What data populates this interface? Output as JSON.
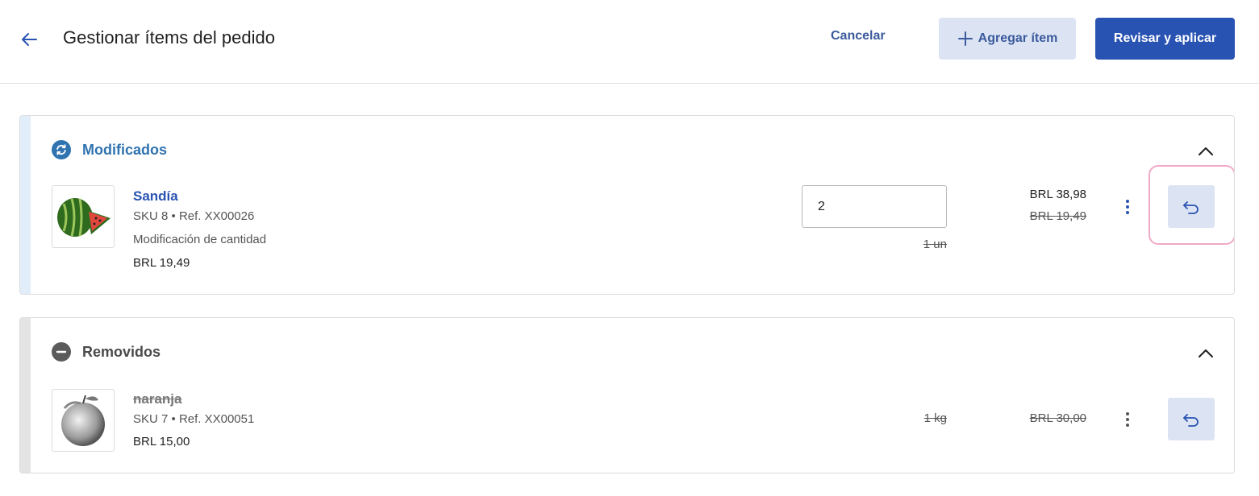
{
  "colors": {
    "primary": "#2953b3",
    "link": "#3a5a9c",
    "secondary_bg": "#dce4f4",
    "modified_accent": "#2f73b0",
    "removed_accent": "#5b5b5b",
    "highlight": "#f0a9c6"
  },
  "header": {
    "back_icon": "arrow-left-icon",
    "title": "Gestionar ítems del pedido",
    "cancel_label": "Cancelar",
    "add_label": "Agregar ítem",
    "add_icon": "plus-icon",
    "apply_label": "Revisar y aplicar"
  },
  "sections": {
    "modified": {
      "title": "Modificados",
      "icon": "sync-icon",
      "items": [
        {
          "name": "Sandía",
          "sku": "SKU 8 • Ref. XX00026",
          "change": "Modificación de cantidad",
          "unit_price": "BRL 19,49",
          "quantity_value": "2",
          "old_quantity": "1 un",
          "new_total": "BRL 38,98",
          "old_total": "BRL 19,49"
        }
      ]
    },
    "removed": {
      "title": "Removidos",
      "icon": "minus-circle-icon",
      "items": [
        {
          "name": "naranja",
          "sku": "SKU 7 • Ref. XX00051",
          "unit_price": "BRL 15,00",
          "old_quantity": "1 kg",
          "old_total": "BRL 30,00"
        }
      ]
    }
  }
}
